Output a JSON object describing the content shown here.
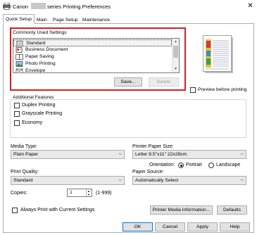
{
  "window": {
    "title_prefix": "Canon",
    "title_suffix": "series Printing Preferences",
    "close_glyph": "✕"
  },
  "tabs": [
    {
      "label": "Quick Setup",
      "active": true
    },
    {
      "label": "Main",
      "active": false
    },
    {
      "label": "Page Setup",
      "active": false
    },
    {
      "label": "Maintenance",
      "active": false
    }
  ],
  "commonly_used": {
    "label": "Commonly Used Settings",
    "items": [
      {
        "label": "Standard",
        "icon": "standard-icon",
        "selected": true
      },
      {
        "label": "Business Document",
        "icon": "business-document-icon",
        "selected": false
      },
      {
        "label": "Paper Saving",
        "icon": "paper-saving-icon",
        "selected": false
      },
      {
        "label": "Photo Printing",
        "icon": "photo-printing-icon",
        "selected": false
      },
      {
        "label": "Envelope",
        "icon": "envelope-icon",
        "selected": false
      }
    ],
    "save_label": "Save...",
    "delete_label": "Delete"
  },
  "preview_before_printing": {
    "label": "Preview before printing",
    "checked": false
  },
  "additional_features": {
    "label": "Additional Features",
    "options": [
      {
        "label": "Duplex Printing",
        "checked": false
      },
      {
        "label": "Grayscale Printing",
        "checked": false
      },
      {
        "label": "Economy",
        "checked": false
      }
    ]
  },
  "media_type": {
    "label": "Media Type:",
    "value": "Plain Paper"
  },
  "printer_paper_size": {
    "label": "Printer Paper Size:",
    "value": "Letter 8.5\"x11\" 22x28cm"
  },
  "orientation": {
    "label": "Orientation:",
    "portrait": "Portrait",
    "landscape": "Landscape",
    "selected": "Portrait"
  },
  "print_quality": {
    "label": "Print Quality:",
    "value": "Standard"
  },
  "paper_source": {
    "label": "Paper Source:",
    "value": "Automatically Select"
  },
  "copies": {
    "label": "Copies:",
    "value": "1",
    "range": "(1-999)"
  },
  "always_print": {
    "label": "Always Print with Current Settings",
    "checked": false
  },
  "buttons": {
    "printer_media_info": "Printer Media Information...",
    "defaults": "Defaults",
    "ok": "OK",
    "cancel": "Cancel",
    "apply": "Apply",
    "help": "Help"
  },
  "colors": {
    "highlight_border": "#d41e24",
    "accent": "#0078d7"
  }
}
